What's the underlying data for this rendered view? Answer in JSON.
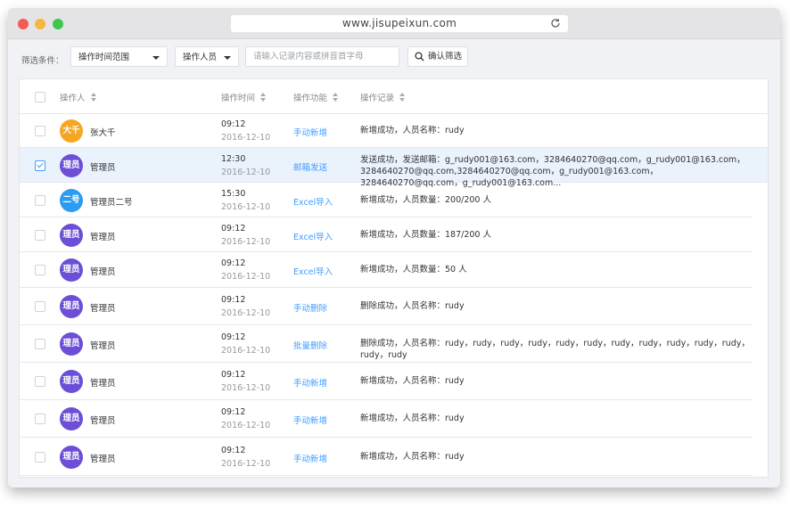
{
  "browser": {
    "url": "www.jisupeixun.com"
  },
  "filter": {
    "label": "筛选条件：",
    "time_range": "操作时间范围",
    "operator": "操作人员",
    "search_placeholder": "请输入记录内容或拼音首字母",
    "confirm": "确认筛选"
  },
  "table": {
    "headers": [
      "操作人",
      "操作时间",
      "操作功能",
      "操作记录"
    ],
    "rows": [
      {
        "avatar": "大千",
        "avatar_color": "#f5a623",
        "name": "张大千",
        "time": "09:12",
        "date": "2016-12-10",
        "func": "手动新增",
        "record": "新增成功，人员名称：rudy",
        "checked": false
      },
      {
        "avatar": "理员",
        "avatar_color": "#6c4fd6",
        "name": "管理员",
        "time": "12:30",
        "date": "2016-12-10",
        "func": "邮箱发送",
        "record": "发送成功，发送邮箱：g_rudy001@163.com，3284640270@qq.com，g_rudy001@163.com，3284640270@qq.com,3284640270@qq.com，g_rudy001@163.com，3284640270@qq.com，g_rudy001@163.com...",
        "checked": true
      },
      {
        "avatar": "二号",
        "avatar_color": "#2d9cf0",
        "name": "管理员二号",
        "time": "15:30",
        "date": "2016-12-10",
        "func": "Excel导入",
        "record": "新增成功，人员数量：200/200 人",
        "checked": false
      },
      {
        "avatar": "理员",
        "avatar_color": "#6c4fd6",
        "name": "管理员",
        "time": "09:12",
        "date": "2016-12-10",
        "func": "Excel导入",
        "record": "新增成功，人员数量：187/200 人",
        "checked": false
      },
      {
        "avatar": "理员",
        "avatar_color": "#6c4fd6",
        "name": "管理员",
        "time": "09:12",
        "date": "2016-12-10",
        "func": "Excel导入",
        "record": "新增成功，人员数量：50 人",
        "checked": false
      },
      {
        "avatar": "理员",
        "avatar_color": "#6c4fd6",
        "name": "管理员",
        "time": "09:12",
        "date": "2016-12-10",
        "func": "手动删除",
        "record": "删除成功，人员名称：rudy",
        "checked": false
      },
      {
        "avatar": "理员",
        "avatar_color": "#6c4fd6",
        "name": "管理员",
        "time": "09:12",
        "date": "2016-12-10",
        "func": "批量删除",
        "record": "删除成功，人员名称：rudy，rudy，rudy，rudy，rudy，rudy，rudy，rudy，rudy，rudy，rudy，rudy，rudy",
        "checked": false
      },
      {
        "avatar": "理员",
        "avatar_color": "#6c4fd6",
        "name": "管理员",
        "time": "09:12",
        "date": "2016-12-10",
        "func": "手动新增",
        "record": "新增成功，人员名称：rudy",
        "checked": false
      },
      {
        "avatar": "理员",
        "avatar_color": "#6c4fd6",
        "name": "管理员",
        "time": "09:12",
        "date": "2016-12-10",
        "func": "手动新增",
        "record": "新增成功，人员名称：rudy",
        "checked": false
      },
      {
        "avatar": "理员",
        "avatar_color": "#6c4fd6",
        "name": "管理员",
        "time": "09:12",
        "date": "2016-12-10",
        "func": "手动新增",
        "record": "新增成功，人员名称：rudy",
        "checked": false
      }
    ]
  }
}
